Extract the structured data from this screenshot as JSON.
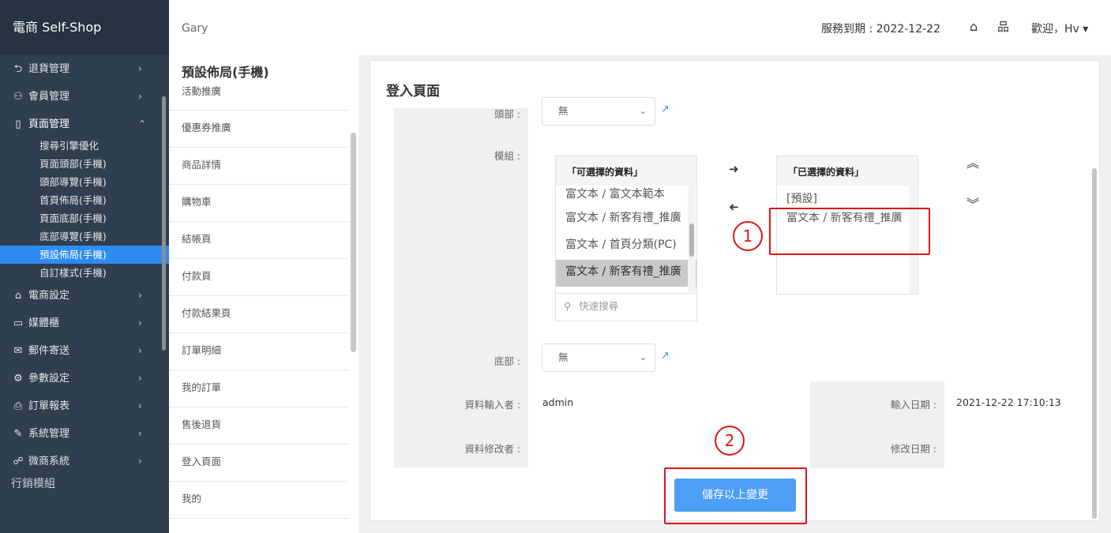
{
  "sidebar": {
    "brand": "電商 Self-Shop",
    "items": [
      {
        "icon": "return-icon",
        "glyph": "⮌",
        "label": "退貨管理"
      },
      {
        "icon": "users-icon",
        "glyph": "⚇",
        "label": "會員管理"
      },
      {
        "icon": "page-icon",
        "glyph": "▯",
        "label": "頁面管理"
      }
    ],
    "sub_items": [
      "搜尋引擎優化",
      "頁面頭部(手機)",
      "頭部導覽(手機)",
      "首頁佈局(手機)",
      "頁面底部(手機)",
      "底部導覽(手機)",
      "預設佈局(手機)",
      "自訂樣式(手機)"
    ],
    "items_after": [
      {
        "icon": "store-icon",
        "glyph": "⌂",
        "label": "電商設定"
      },
      {
        "icon": "folder-icon",
        "glyph": "▭",
        "label": "媒體櫃"
      },
      {
        "icon": "mail-icon",
        "glyph": "✉",
        "label": "郵件寄送"
      },
      {
        "icon": "settings-icon",
        "glyph": "⚙",
        "label": "參數設定"
      },
      {
        "icon": "printer-icon",
        "glyph": "⎙",
        "label": "訂單報表"
      },
      {
        "icon": "tools-icon",
        "glyph": "✎",
        "label": "系統管理"
      },
      {
        "icon": "network-icon",
        "glyph": "☍",
        "label": "微商系統"
      }
    ],
    "cut_item": "行銷模組"
  },
  "mid": {
    "user": "Gary",
    "title": "預設佈局(手機)",
    "items": [
      "活動推廣",
      "優惠券推廣",
      "商品詳情",
      "購物車",
      "結帳頁",
      "付款頁",
      "付款結果頁",
      "訂單明細",
      "我的訂單",
      "售後退貨",
      "登入頁面",
      "我的"
    ]
  },
  "header": {
    "expire": "服務到期 : 2022-12-22",
    "welcome": "歡迎，Hv ▾"
  },
  "form": {
    "page_title": "登入頁面",
    "head_label": "頭部 :",
    "head_value": "無",
    "module_label": "模組 :",
    "footer_label": "底部 :",
    "footer_value": "無",
    "creator_label": "資料輸入者 :",
    "creator_value": "admin",
    "modifier_label": "資料修改者 :",
    "input_date_label": "輸入日期 :",
    "input_date_value": "2021-12-22 17:10:13",
    "modify_date_label": "修改日期 :",
    "save_label": "儲存以上變更"
  },
  "transfer": {
    "available_title": "「可選擇的資料」",
    "available_items": [
      "富文本 / 富文本範本",
      "富文本 / 新客有禮_推廣",
      "富文本 / 首頁分類(PC)",
      "富文本 / 新客有禮_推廣"
    ],
    "search_placeholder": "快速搜尋",
    "selected_title": "「已選擇的資料」",
    "selected_items": [
      "[預設]",
      "富文本 / 新客有禮_推廣"
    ]
  },
  "annotations": {
    "one": "1",
    "two": "2"
  },
  "colors": {
    "sidebar_bg": "#2f3f50",
    "active": "#2d8cf0",
    "button": "#4c9ef6",
    "annotation": "#e01515"
  }
}
